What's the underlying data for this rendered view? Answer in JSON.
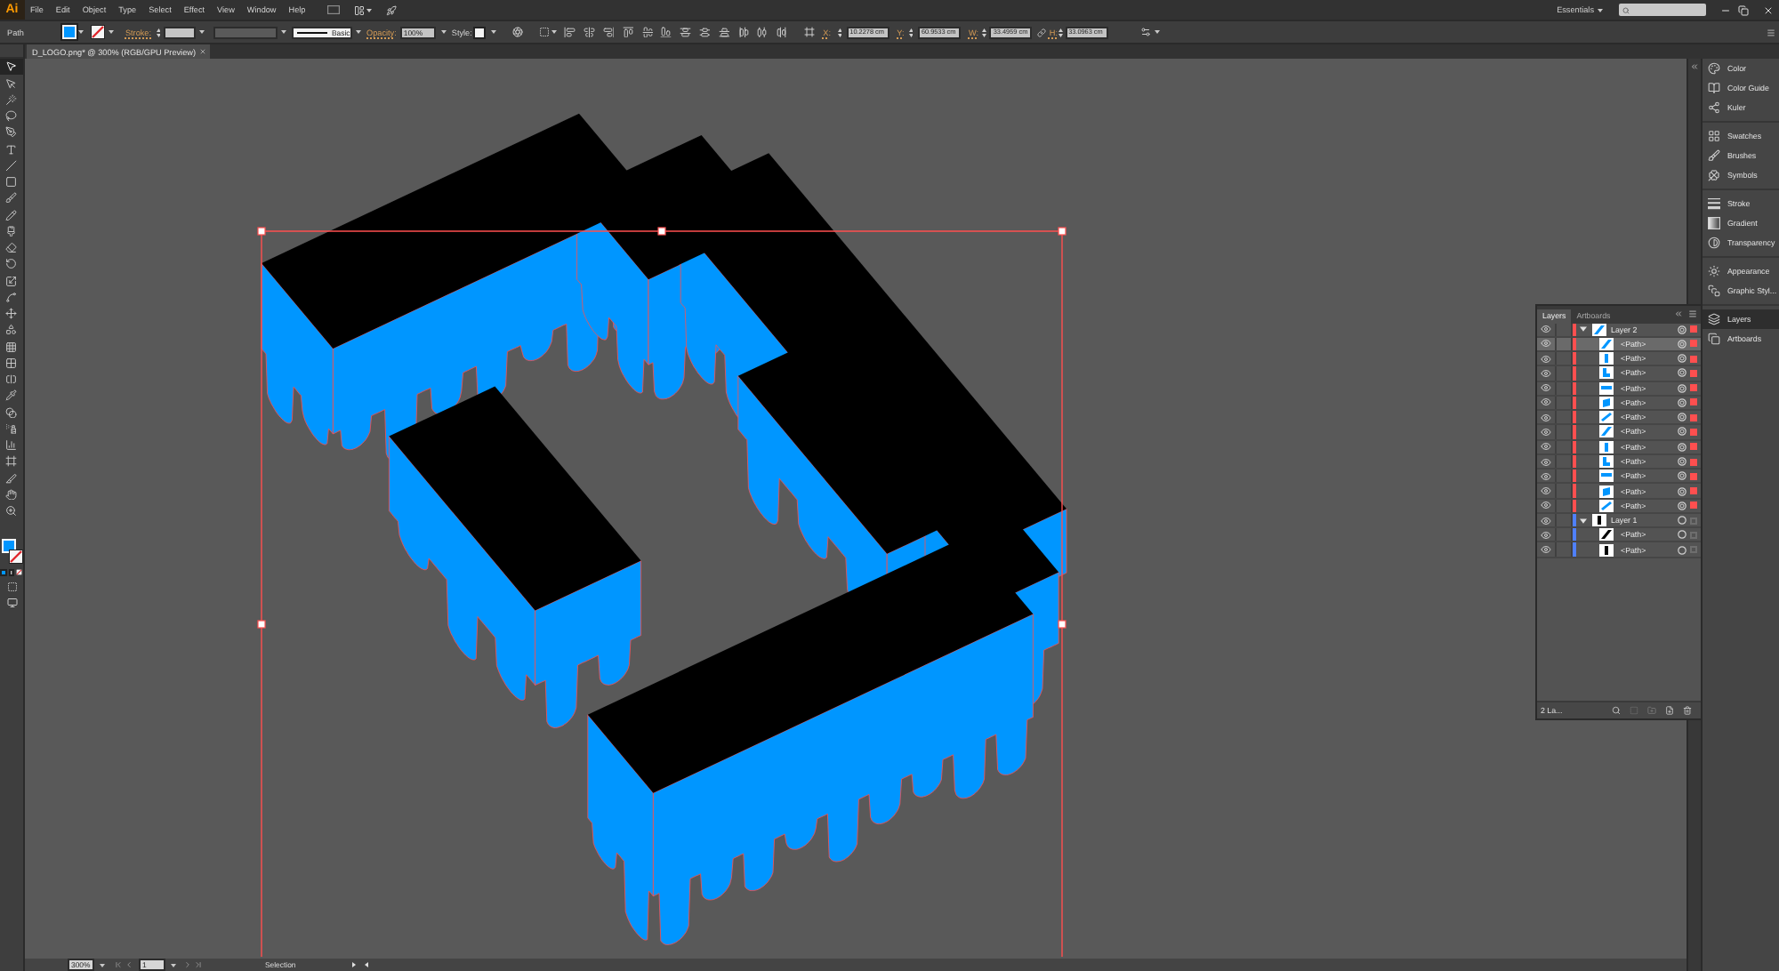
{
  "app": {
    "logo": "Ai"
  },
  "menu_bar": {
    "items": [
      "File",
      "Edit",
      "Object",
      "Type",
      "Select",
      "Effect",
      "View",
      "Window",
      "Help"
    ],
    "workspace": "Essentials"
  },
  "control_bar": {
    "selection": "Path",
    "stroke_label": "Stroke:",
    "brush": "Basic",
    "opacity_label": "Opacity:",
    "opacity": "100%",
    "style_label": "Style:",
    "transform": [
      {
        "label": "X:",
        "value": "10.2278 cm"
      },
      {
        "label": "Y:",
        "value": "60.9533 cm"
      },
      {
        "label": "W:",
        "value": "33.4959 cm"
      },
      {
        "label": "H:",
        "value": "33.0963 cm"
      }
    ]
  },
  "document_tab": {
    "title": "D_LOGO.png* @ 300% (RGB/GPU Preview)"
  },
  "tools": [
    {
      "kind": "selection",
      "selected": true
    },
    {
      "kind": "direct_selection",
      "selected": false
    },
    {
      "kind": "magic_wand",
      "selected": false
    },
    {
      "kind": "lasso",
      "selected": false
    },
    {
      "kind": "pen",
      "selected": false
    },
    {
      "kind": "type",
      "selected": false
    },
    {
      "kind": "line",
      "selected": false
    },
    {
      "kind": "rectangle",
      "selected": false
    },
    {
      "kind": "paintbrush",
      "selected": false
    },
    {
      "kind": "pencil",
      "selected": false
    },
    {
      "kind": "blob_brush",
      "selected": false
    },
    {
      "kind": "eraser",
      "selected": false
    },
    {
      "kind": "rotate",
      "selected": false
    },
    {
      "kind": "scale",
      "selected": false
    },
    {
      "kind": "width",
      "selected": false
    },
    {
      "kind": "free_transform",
      "selected": false
    },
    {
      "kind": "shape_builder",
      "selected": false
    },
    {
      "kind": "perspective_grid",
      "selected": false
    },
    {
      "kind": "mesh",
      "selected": false
    },
    {
      "kind": "gradient",
      "selected": false
    },
    {
      "kind": "eyedropper",
      "selected": false
    },
    {
      "kind": "blend",
      "selected": false
    },
    {
      "kind": "symbol_sprayer",
      "selected": false
    },
    {
      "kind": "graph",
      "selected": false
    },
    {
      "kind": "artboard",
      "selected": false
    },
    {
      "kind": "slice",
      "selected": false
    },
    {
      "kind": "hand",
      "selected": false
    },
    {
      "kind": "zoom",
      "selected": false
    }
  ],
  "dock": {
    "groups": [
      {
        "items": [
          {
            "kind": "color",
            "label": "Color",
            "selected": false
          },
          {
            "kind": "color_guide",
            "label": "Color Guide",
            "selected": false
          },
          {
            "kind": "kuler",
            "label": "Kuler",
            "selected": false
          }
        ]
      },
      {
        "items": [
          {
            "kind": "swatches",
            "label": "Swatches",
            "selected": false
          },
          {
            "kind": "brushes",
            "label": "Brushes",
            "selected": false
          },
          {
            "kind": "symbols",
            "label": "Symbols",
            "selected": false
          }
        ]
      },
      {
        "items": [
          {
            "kind": "stroke",
            "label": "Stroke",
            "selected": false
          },
          {
            "kind": "gradient",
            "label": "Gradient",
            "selected": false
          },
          {
            "kind": "transparency",
            "label": "Transparency",
            "selected": false
          }
        ]
      },
      {
        "items": [
          {
            "kind": "appearance",
            "label": "Appearance",
            "selected": false
          },
          {
            "kind": "graphic_styles",
            "label": "Graphic Styl...",
            "selected": false
          }
        ]
      },
      {
        "items": [
          {
            "kind": "layers",
            "label": "Layers",
            "selected": true
          },
          {
            "kind": "artboards",
            "label": "Artboards",
            "selected": false
          }
        ]
      }
    ]
  },
  "layers_panel": {
    "tabs": [
      {
        "label": "Layers",
        "selected": true
      },
      {
        "label": "Artboards",
        "selected": false
      }
    ],
    "layers": [
      {
        "name": "Layer 2",
        "color": "#ff4f4f",
        "expanded": true,
        "visible": true,
        "selected": false,
        "art_selected": true,
        "children": [
          {
            "name": "<Path>",
            "color": "#0096ff",
            "visible": true,
            "selected": true,
            "art_selected": true
          },
          {
            "name": "<Path>",
            "color": "#0096ff",
            "visible": true,
            "selected": false,
            "art_selected": true
          },
          {
            "name": "<Path>",
            "color": "#0096ff",
            "visible": true,
            "selected": false,
            "art_selected": true
          },
          {
            "name": "<Path>",
            "color": "#0096ff",
            "visible": true,
            "selected": false,
            "art_selected": true
          },
          {
            "name": "<Path>",
            "color": "#0096ff",
            "visible": true,
            "selected": false,
            "art_selected": true
          },
          {
            "name": "<Path>",
            "color": "#0096ff",
            "visible": true,
            "selected": false,
            "art_selected": true
          },
          {
            "name": "<Path>",
            "color": "#0096ff",
            "visible": true,
            "selected": false,
            "art_selected": true
          },
          {
            "name": "<Path>",
            "color": "#0096ff",
            "visible": true,
            "selected": false,
            "art_selected": true
          },
          {
            "name": "<Path>",
            "color": "#0096ff",
            "visible": true,
            "selected": false,
            "art_selected": true
          },
          {
            "name": "<Path>",
            "color": "#0096ff",
            "visible": true,
            "selected": false,
            "art_selected": true
          },
          {
            "name": "<Path>",
            "color": "#0096ff",
            "visible": true,
            "selected": false,
            "art_selected": true
          },
          {
            "name": "<Path>",
            "color": "#0096ff",
            "visible": true,
            "selected": false,
            "art_selected": true
          }
        ]
      },
      {
        "name": "Layer 1",
        "color": "#4f80ff",
        "expanded": true,
        "visible": true,
        "selected": false,
        "art_selected": false,
        "children": [
          {
            "name": "<Path>",
            "color": "#000000",
            "visible": true,
            "selected": false,
            "art_selected": false
          },
          {
            "name": "<Path>",
            "color": "#000000",
            "visible": true,
            "selected": false,
            "art_selected": false
          }
        ]
      }
    ],
    "footer": "2 La..."
  },
  "status_bar": {
    "zoom": "300%",
    "artboard": "1",
    "tool": "Selection"
  }
}
